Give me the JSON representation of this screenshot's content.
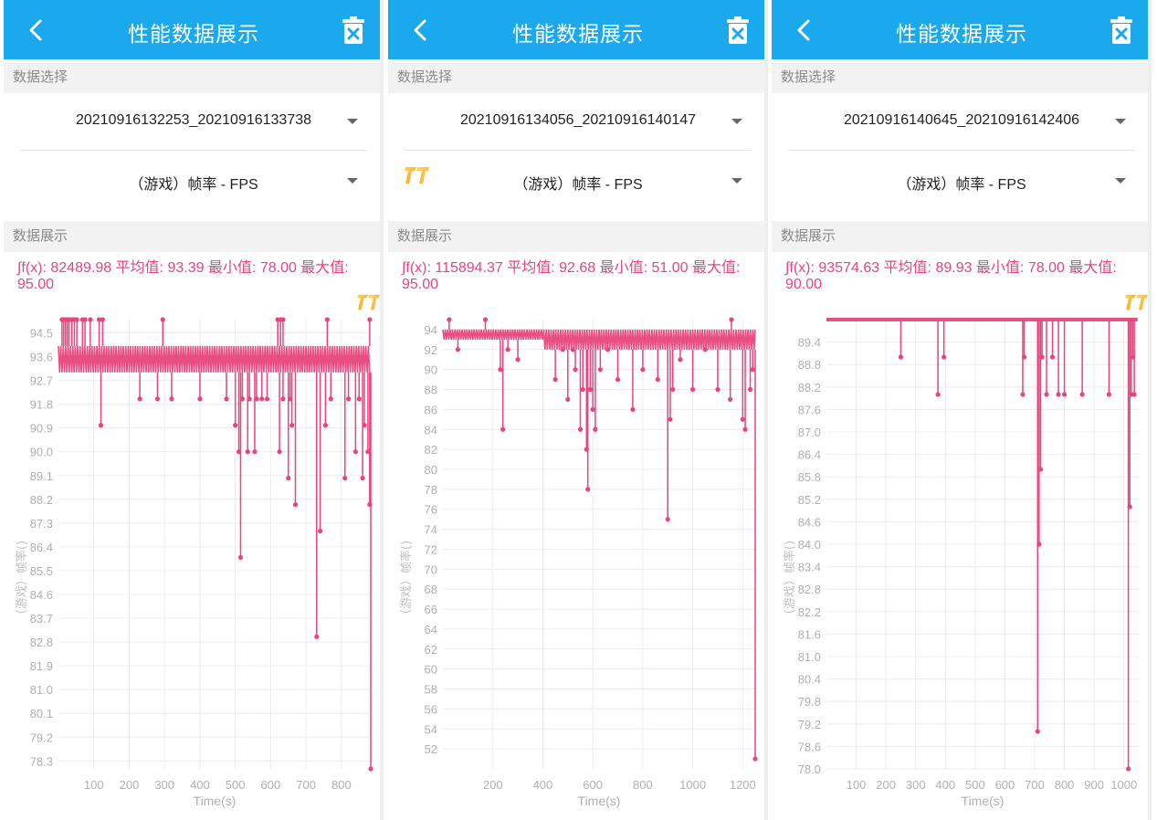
{
  "panels": [
    {
      "title": "性能数据展示",
      "data_select_label": "数据选择",
      "file_value": "20210916132253_20210916133738",
      "metric_value": "（游戏）帧率 - FPS",
      "display_label": "数据展示",
      "stats_text": "∫f(x): 82489.98 平均值: 93.39 最小值: 78.00 最大值: 95.00",
      "logo_above_chart": true,
      "logo_in_select": false,
      "chart_data": {
        "type": "line",
        "xlabel": "Time(s)",
        "ylabel": "（游戏）帧率()",
        "xlim": [
          0,
          883
        ],
        "ylim": [
          78.0,
          95.0
        ],
        "x_ticks": [
          100,
          200,
          300,
          400,
          500,
          600,
          700,
          800
        ],
        "y_ticks": [
          "94.5",
          "93.6",
          "92.7",
          "91.8",
          "90.9",
          "90.0",
          "89.1",
          "88.2",
          "87.3",
          "86.4",
          "85.5",
          "84.6",
          "83.7",
          "82.8",
          "81.9",
          "81.0",
          "80.1",
          "79.2",
          "78.3"
        ],
        "grid": true,
        "series": [
          {
            "color": "#e8457b",
            "base_band": [
              93,
              94
            ],
            "highs": [
              [
                10,
                95
              ],
              [
                15,
                95
              ],
              [
                20,
                95
              ],
              [
                25,
                95
              ],
              [
                30,
                95
              ],
              [
                38,
                95
              ],
              [
                45,
                95
              ],
              [
                52,
                95
              ],
              [
                68,
                95
              ],
              [
                75,
                95
              ],
              [
                90,
                95
              ],
              [
                115,
                95
              ],
              [
                125,
                95
              ],
              [
                295,
                95
              ],
              [
                620,
                95
              ],
              [
                628,
                95
              ],
              [
                635,
                95
              ],
              [
                760,
                95
              ],
              [
                880,
                95
              ]
            ],
            "spikes_down": [
              [
                120,
                91
              ],
              [
                230,
                92
              ],
              [
                280,
                92
              ],
              [
                320,
                92
              ],
              [
                400,
                92
              ],
              [
                475,
                92
              ],
              [
                500,
                91
              ],
              [
                510,
                90
              ],
              [
                515,
                86
              ],
              [
                520,
                92
              ],
              [
                535,
                90
              ],
              [
                540,
                92
              ],
              [
                555,
                90
              ],
              [
                560,
                92
              ],
              [
                575,
                92
              ],
              [
                590,
                92
              ],
              [
                625,
                90
              ],
              [
                635,
                92
              ],
              [
                650,
                89
              ],
              [
                655,
                92
              ],
              [
                660,
                91
              ],
              [
                670,
                88
              ],
              [
                730,
                83
              ],
              [
                740,
                87
              ],
              [
                755,
                91
              ],
              [
                770,
                92
              ],
              [
                810,
                89
              ],
              [
                820,
                92
              ],
              [
                840,
                90
              ],
              [
                850,
                92
              ],
              [
                860,
                89
              ],
              [
                865,
                91
              ],
              [
                875,
                90
              ],
              [
                880,
                88
              ],
              [
                883,
                78
              ]
            ]
          }
        ]
      }
    },
    {
      "title": "性能数据展示",
      "data_select_label": "数据选择",
      "file_value": "20210916134056_20210916140147",
      "metric_value": "（游戏）帧率 - FPS",
      "display_label": "数据展示",
      "stats_text": "∫f(x): 115894.37 平均值: 92.68 最小值: 51.00 最大值: 95.00",
      "logo_above_chart": false,
      "logo_in_select": true,
      "chart_data": {
        "type": "line",
        "xlabel": "Time(s)",
        "ylabel": "（游戏）帧率()",
        "xlim": [
          0,
          1250
        ],
        "ylim": [
          50.0,
          95.0
        ],
        "x_ticks": [
          200,
          400,
          600,
          800,
          1000,
          1200
        ],
        "y_ticks": [
          "94",
          "92",
          "90",
          "88",
          "86",
          "84",
          "82",
          "80",
          "78",
          "76",
          "74",
          "72",
          "70",
          "68",
          "66",
          "64",
          "62",
          "60",
          "58",
          "56",
          "54",
          "52"
        ],
        "grid": true,
        "series": [
          {
            "color": "#e8457b",
            "base_band": [
              93,
              94
            ],
            "second_band": {
              "from": 400,
              "values": [
                92,
                94
              ]
            },
            "highs": [
              [
                25,
                95
              ],
              [
                170,
                95
              ],
              [
                1155,
                95
              ]
            ],
            "spikes_down": [
              [
                60,
                92
              ],
              [
                230,
                90
              ],
              [
                240,
                84
              ],
              [
                260,
                92
              ],
              [
                300,
                91
              ],
              [
                450,
                89
              ],
              [
                480,
                92
              ],
              [
                500,
                87
              ],
              [
                520,
                92
              ],
              [
                530,
                90
              ],
              [
                550,
                84
              ],
              [
                560,
                88
              ],
              [
                575,
                82
              ],
              [
                580,
                78
              ],
              [
                590,
                88
              ],
              [
                600,
                86
              ],
              [
                610,
                84
              ],
              [
                630,
                90
              ],
              [
                660,
                92
              ],
              [
                700,
                89
              ],
              [
                760,
                86
              ],
              [
                800,
                90
              ],
              [
                860,
                89
              ],
              [
                900,
                75
              ],
              [
                910,
                85
              ],
              [
                920,
                88
              ],
              [
                950,
                91
              ],
              [
                1000,
                88
              ],
              [
                1050,
                92
              ],
              [
                1100,
                88
              ],
              [
                1150,
                87
              ],
              [
                1200,
                85
              ],
              [
                1210,
                84
              ],
              [
                1230,
                88
              ],
              [
                1240,
                90
              ],
              [
                1250,
                51
              ]
            ]
          }
        ]
      }
    },
    {
      "title": "性能数据展示",
      "data_select_label": "数据选择",
      "file_value": "20210916140645_20210916142406",
      "metric_value": "（游戏）帧率 - FPS",
      "display_label": "数据展示",
      "stats_text": "∫f(x): 93574.63 平均值: 89.93 最小值: 78.00 最大值: 90.00",
      "logo_above_chart": true,
      "logo_in_select": false,
      "chart_data": {
        "type": "line",
        "xlabel": "Time(s)",
        "ylabel": "（游戏）帧率()",
        "xlim": [
          0,
          1050
        ],
        "ylim": [
          78.0,
          90.0
        ],
        "x_ticks": [
          100,
          200,
          300,
          400,
          500,
          600,
          700,
          800,
          900,
          1000
        ],
        "y_ticks": [
          "89.4",
          "88.8",
          "88.2",
          "87.6",
          "87.0",
          "86.4",
          "85.8",
          "85.2",
          "84.6",
          "84.0",
          "83.4",
          "82.8",
          "82.2",
          "81.6",
          "81.0",
          "80.4",
          "79.8",
          "79.2",
          "78.6",
          "78.0"
        ],
        "grid": true,
        "series": [
          {
            "color": "#e8457b",
            "base_band": [
              90,
              90
            ],
            "highs": [],
            "spikes_down": [
              [
                250,
                89
              ],
              [
                375,
                88
              ],
              [
                395,
                89
              ],
              [
                660,
                88
              ],
              [
                665,
                89
              ],
              [
                710,
                79
              ],
              [
                715,
                84
              ],
              [
                720,
                86
              ],
              [
                725,
                89
              ],
              [
                740,
                88
              ],
              [
                760,
                89
              ],
              [
                780,
                88
              ],
              [
                800,
                88
              ],
              [
                860,
                88
              ],
              [
                950,
                88
              ],
              [
                1015,
                78
              ],
              [
                1020,
                85
              ],
              [
                1025,
                88
              ],
              [
                1030,
                89
              ],
              [
                1035,
                88
              ]
            ]
          }
        ]
      }
    }
  ]
}
